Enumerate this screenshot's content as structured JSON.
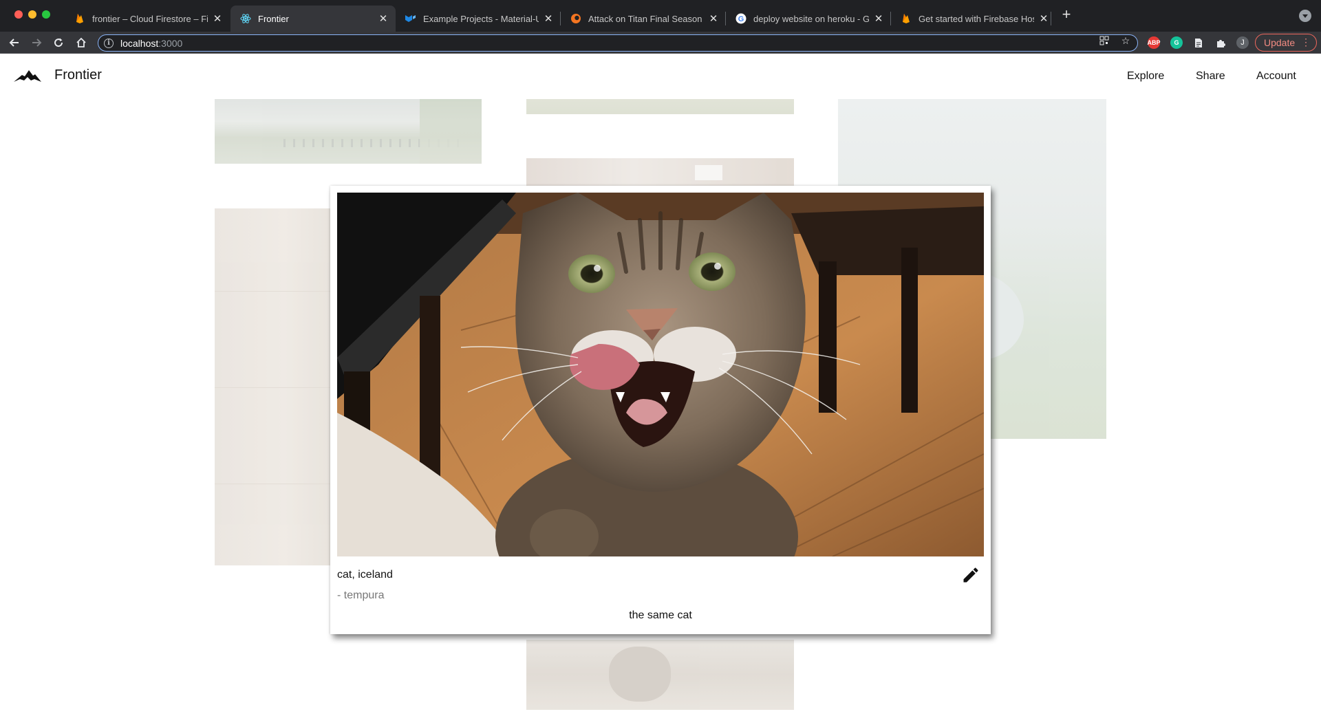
{
  "browser": {
    "tabs": [
      {
        "title": "frontier – Cloud Firestore – Fire",
        "icon": "firebase-icon",
        "active": false
      },
      {
        "title": "Frontier",
        "icon": "react-icon",
        "active": true
      },
      {
        "title": "Example Projects - Material-UI",
        "icon": "material-ui-icon",
        "active": false
      },
      {
        "title": "Attack on Titan Final Season Ep",
        "icon": "crunchyroll-icon",
        "active": false
      },
      {
        "title": "deploy website on heroku - Go",
        "icon": "google-icon",
        "active": false
      },
      {
        "title": "Get started with Firebase Hosti",
        "icon": "firebase-icon",
        "active": false
      }
    ],
    "url_host": "localhost",
    "url_port": ":3000",
    "update_label": "Update",
    "profile_initial": "J",
    "extensions": [
      "adblock-icon",
      "grammarly-icon",
      "document-icon",
      "puzzle-icon"
    ]
  },
  "app": {
    "brand": "Frontier",
    "nav": [
      "Explore",
      "Share",
      "Account"
    ]
  },
  "modal": {
    "title": "cat, iceland",
    "author": "- tempura",
    "caption": "the same cat"
  },
  "colors": {
    "chrome_bg": "#202124",
    "toolbar_bg": "#35363a",
    "update_accent": "#f28b82"
  }
}
